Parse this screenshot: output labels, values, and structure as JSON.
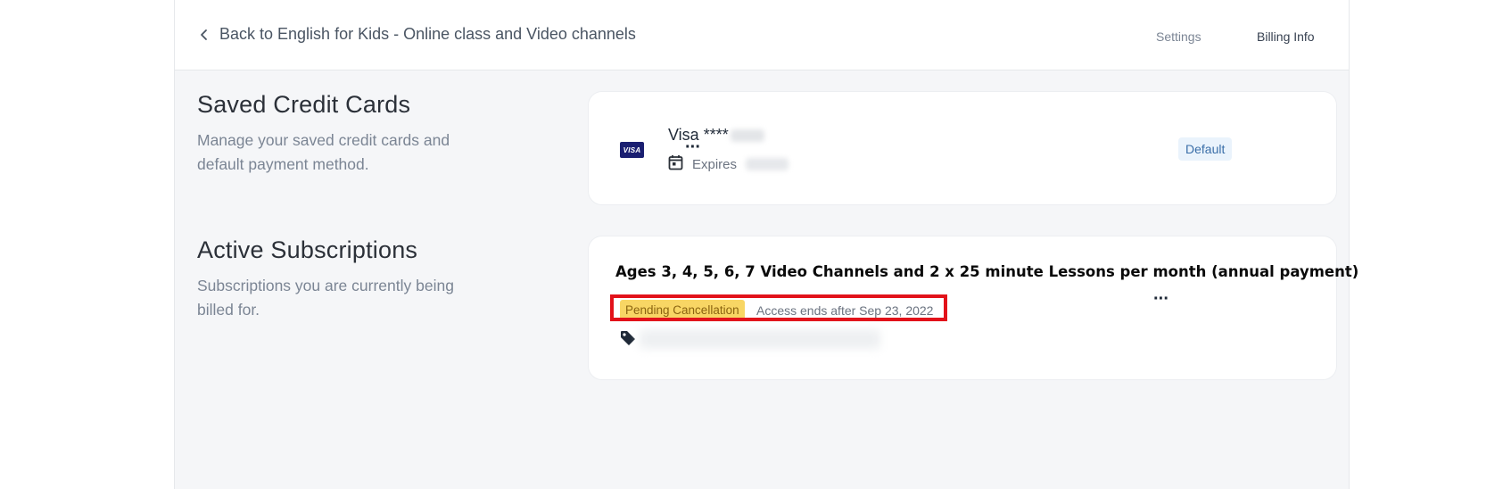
{
  "header": {
    "back_label": "Back to English for Kids - Online class and Video channels",
    "nav": [
      {
        "label": "Settings"
      },
      {
        "label": "Billing Info"
      }
    ]
  },
  "saved_cards": {
    "title": "Saved Credit Cards",
    "description": "Manage your saved credit cards and default payment method.",
    "card": {
      "brand_icon_text": "VISA",
      "name_prefix": "Visa ****",
      "expires_label": "Expires",
      "default_badge": "Default"
    },
    "menu_glyph": "···"
  },
  "subscriptions": {
    "title": "Active Subscriptions",
    "description": "Subscriptions you are currently being billed for.",
    "item": {
      "title": "Ages 3, 4, 5, 6, 7  Video Channels and 2 x 25 minute Lessons per month (annual payment)",
      "status_badge": "Pending Cancellation",
      "access_text": "Access ends after Sep 23, 2022"
    },
    "menu_glyph": "···"
  },
  "colors": {
    "highlight": "#e2121a",
    "pending": "#f8d664",
    "visa_blue": "#1a1f71",
    "default_badge_bg": "#eaf3fc"
  },
  "icons": [
    "chevron-left-icon",
    "visa-card-icon",
    "calendar-icon",
    "tag-icon",
    "more-options-icon"
  ]
}
